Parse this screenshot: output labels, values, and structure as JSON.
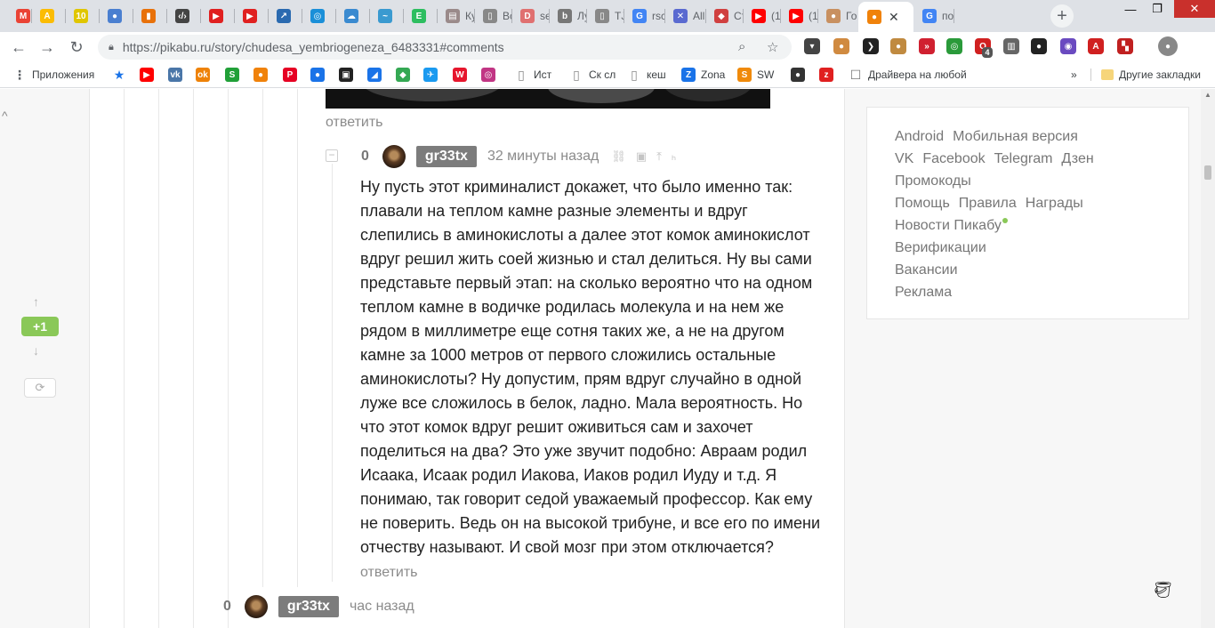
{
  "browser": {
    "tabs": [
      {
        "title": "",
        "icon": "gmail-icon",
        "color": "#ea4335",
        "glyph": "M"
      },
      {
        "title": "",
        "icon": "google-ads-icon",
        "color": "#fbbc04",
        "glyph": "A"
      },
      {
        "title": "",
        "icon": "ten-icon",
        "color": "#e0c600",
        "glyph": "10"
      },
      {
        "title": "",
        "icon": "circle-icon",
        "color": "#4a7fd0",
        "glyph": "●"
      },
      {
        "title": "",
        "icon": "bars-icon",
        "color": "#e8710a",
        "glyph": "▮"
      },
      {
        "title": "",
        "icon": "code-icon",
        "color": "#444444",
        "glyph": "‹/›"
      },
      {
        "title": "",
        "icon": "play-icon",
        "color": "#e02020",
        "glyph": "▶"
      },
      {
        "title": "",
        "icon": "play-icon",
        "color": "#e02020",
        "glyph": "▶"
      },
      {
        "title": "",
        "icon": "chart-icon",
        "color": "#2a6ab0",
        "glyph": "↗"
      },
      {
        "title": "",
        "icon": "ring-icon",
        "color": "#1a8fd8",
        "glyph": "◎"
      },
      {
        "title": "",
        "icon": "cloud-icon",
        "color": "#3a8ad0",
        "glyph": "☁"
      },
      {
        "title": "",
        "icon": "wave-icon",
        "color": "#3a9ad0",
        "glyph": "~"
      },
      {
        "title": "",
        "icon": "evernote-icon",
        "color": "#2dbe60",
        "glyph": "E"
      },
      {
        "title": "Ку",
        "icon": "page-icon",
        "color": "#9a8a8a",
        "glyph": "▤"
      },
      {
        "title": "Вс",
        "icon": "document-icon",
        "color": "#888888",
        "glyph": "▯"
      },
      {
        "title": "se",
        "icon": "box-icon",
        "color": "#e07070",
        "glyph": "D"
      },
      {
        "title": "Лу",
        "icon": "b-icon",
        "color": "#777777",
        "glyph": "b"
      },
      {
        "title": "TJ",
        "icon": "document-icon",
        "color": "#888888",
        "glyph": "▯"
      },
      {
        "title": "rsc",
        "icon": "google-icon",
        "color": "#4285f4",
        "glyph": "G"
      },
      {
        "title": "All",
        "icon": "cross-icon",
        "color": "#5a6ad0",
        "glyph": "✕"
      },
      {
        "title": "Ст",
        "icon": "shield-icon",
        "color": "#d04040",
        "glyph": "◆"
      },
      {
        "title": "(1)",
        "icon": "youtube-icon",
        "color": "#ff0000",
        "glyph": "▶"
      },
      {
        "title": "(1)",
        "icon": "youtube-icon",
        "color": "#ff0000",
        "glyph": "▶"
      },
      {
        "title": "Го",
        "icon": "potato-icon",
        "color": "#c89060",
        "glyph": "●"
      },
      {
        "title": "",
        "icon": "pikabu-icon",
        "color": "#f0820a",
        "glyph": "●"
      },
      {
        "title": "по",
        "icon": "google-icon",
        "color": "#4285f4",
        "glyph": "G"
      }
    ],
    "new_tab_glyph": "+",
    "close_tab_glyph": "✕",
    "url": "https://pikabu.ru/story/chudesa_yembriogeneza_6483331#comments",
    "window_controls": [
      "—",
      "❐",
      "✕"
    ],
    "extensions": [
      {
        "icon": "pocket-icon",
        "color": "#444444",
        "glyph": "▾"
      },
      {
        "icon": "cat-icon",
        "color": "#d08a40",
        "glyph": "●"
      },
      {
        "icon": "arrow-icon",
        "color": "#222222",
        "glyph": "❯"
      },
      {
        "icon": "cookie-icon",
        "color": "#c08a40",
        "glyph": "●"
      },
      {
        "icon": "ff-icon",
        "color": "#d02030",
        "glyph": "»"
      },
      {
        "icon": "ring-icon",
        "color": "#2a9a3a",
        "glyph": "◎"
      },
      {
        "icon": "opera-icon",
        "color": "#d02020",
        "glyph": "O"
      },
      {
        "icon": "stats-icon",
        "color": "#666666",
        "glyph": "▥"
      },
      {
        "icon": "face-icon",
        "color": "#222222",
        "glyph": "●"
      },
      {
        "icon": "lens-icon",
        "color": "#6a4ac0",
        "glyph": "◉"
      },
      {
        "icon": "pdf-icon",
        "color": "#d02020",
        "glyph": "A"
      },
      {
        "icon": "puzzle-icon",
        "color": "#c02020",
        "glyph": "▚"
      },
      {
        "icon": "profile-icon",
        "color": "#888888",
        "glyph": "●"
      }
    ],
    "extension_badge": "4",
    "bookmarks": [
      {
        "label": "Приложения",
        "icon": "apps-icon",
        "color": "#5f6368",
        "glyph": "⋮"
      },
      {
        "label": "",
        "icon": "star-icon",
        "color": "#1a73e8",
        "glyph": "★"
      },
      {
        "label": "",
        "icon": "youtube-icon",
        "color": "#ff0000",
        "glyph": "▶"
      },
      {
        "label": "",
        "icon": "vk-icon",
        "color": "#4a76a8",
        "glyph": "vk"
      },
      {
        "label": "",
        "icon": "ok-icon",
        "color": "#ee8208",
        "glyph": "ok"
      },
      {
        "label": "",
        "icon": "sber-icon",
        "color": "#21a038",
        "glyph": "S"
      },
      {
        "label": "",
        "icon": "pikabu-icon",
        "color": "#f0820a",
        "glyph": "●"
      },
      {
        "label": "",
        "icon": "pinterest-icon",
        "color": "#e60023",
        "glyph": "P"
      },
      {
        "label": "",
        "icon": "drop-icon",
        "color": "#1a73e8",
        "glyph": "●"
      },
      {
        "label": "",
        "icon": "box-icon",
        "color": "#222222",
        "glyph": "▣"
      },
      {
        "label": "",
        "icon": "fish-icon",
        "color": "#1a73e8",
        "glyph": "◢"
      },
      {
        "label": "",
        "icon": "maps-icon",
        "color": "#34a853",
        "glyph": "◆"
      },
      {
        "label": "",
        "icon": "plane-icon",
        "color": "#1a9af0",
        "glyph": "✈"
      },
      {
        "label": "",
        "icon": "weibo-icon",
        "color": "#e6162d",
        "glyph": "W"
      },
      {
        "label": "",
        "icon": "instagram-icon",
        "color": "#c13584",
        "glyph": "◎"
      },
      {
        "label": "Ист",
        "icon": "page-icon",
        "color": "#888888",
        "glyph": "▯"
      },
      {
        "label": "Ск сл",
        "icon": "page-icon",
        "color": "#888888",
        "glyph": "▯"
      },
      {
        "label": "кеш",
        "icon": "page-icon",
        "color": "#888888",
        "glyph": "▯"
      },
      {
        "label": "Zona",
        "icon": "zona-icon",
        "color": "#1a73e8",
        "glyph": "Z"
      },
      {
        "label": "SW",
        "icon": "sw-icon",
        "color": "#f08a0a",
        "glyph": "S"
      },
      {
        "label": "",
        "icon": "person-icon",
        "color": "#333333",
        "glyph": "●"
      },
      {
        "label": "",
        "icon": "zoom-icon",
        "color": "#e02020",
        "glyph": "z"
      },
      {
        "label": "Драйвера на любой",
        "icon": "checkbox-icon",
        "color": "#777777",
        "glyph": "☐"
      }
    ],
    "bookmarks_overflow": "»",
    "other_bookmarks": "Другие закладки"
  },
  "page": {
    "left_vote": {
      "score": "+1",
      "up": "↑",
      "down": "↓",
      "refresh": "⟳",
      "top": "^"
    },
    "reply_label_top": "ответить",
    "comment": {
      "rating": "0",
      "author": "gr33tx",
      "time": "32 минуты назад",
      "text": "Ну пусть этот криминалист докажет, что было именно так: плавали на теплом камне разные элементы и вдруг слепились в аминокислоты а далее этот комок аминокислот вдруг решил жить соей жизнью и стал делиться. Ну вы сами представьте первый этап: на сколько вероятно что на одном теплом камне в водичке родилась молекула и на нем же рядом в миллиметре еще сотня таких же, а не на другом камне за 1000 метров от первого сложились остальные аминокислоты? Ну допустим, прям вдруг случайно в одной луже все сложилось в белок, ладно. Мала вероятность. Но что этот комок вдруг решит оживиться сам и захочет поделиться на два? Это уже звучит подобно: Авраам родил Исаака, Исаак родил Иакова, Иаков родил Иуду и т.д. Я понимаю, так говорит седой уважаемый профессор. Как ему не поверить. Ведь он на высокой трибуне, и все его по имени отчеству называют. И свой мозг при этом отключается?",
      "reply_label": "ответить",
      "collapse": "−"
    },
    "next_comment": {
      "rating": "0",
      "author": "gr33tx",
      "time": "час назад"
    },
    "sidebar_links": {
      "row1": [
        "Android",
        "Мобильная версия"
      ],
      "row2": [
        "VK",
        "Facebook",
        "Telegram",
        "Дзен"
      ],
      "row3": [
        "Промокоды"
      ],
      "row4": [
        "Помощь",
        "Правила",
        "Награды"
      ],
      "row5": [
        "Новости Пикабу"
      ],
      "row6": [
        "Верификации"
      ],
      "row7": [
        "Вакансии"
      ],
      "row8": [
        "Реклама"
      ]
    },
    "accent_color": "#8ac858"
  }
}
